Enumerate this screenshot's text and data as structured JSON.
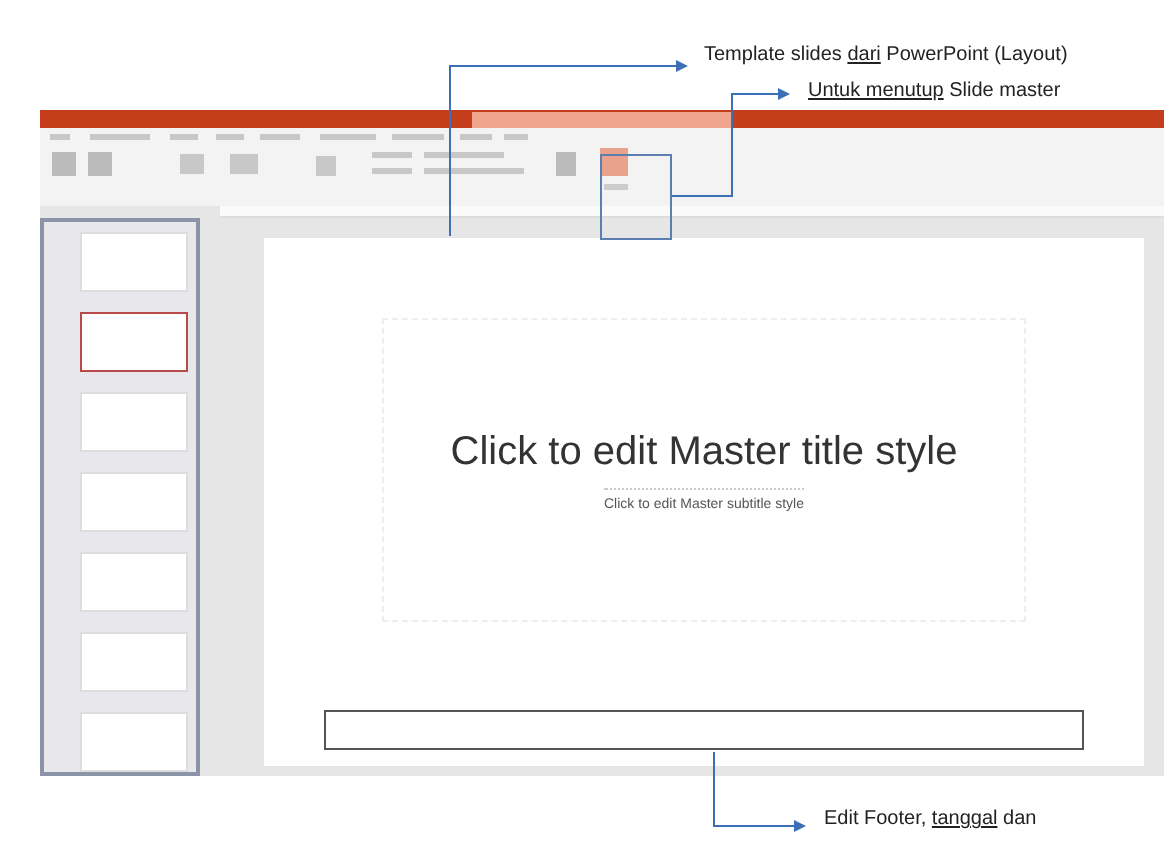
{
  "annotations": [
    {
      "kind": "layout",
      "parts": [
        {
          "text": "Template slides ",
          "underlined": false
        },
        {
          "text": "dari",
          "underlined": true
        },
        {
          "text": " PowerPoint (Layout)",
          "underlined": false
        }
      ]
    },
    {
      "kind": "close",
      "parts": [
        {
          "text": "Untuk menutup",
          "underlined": true
        },
        {
          "text": " Slide master",
          "underlined": false
        }
      ]
    },
    {
      "kind": "footer",
      "parts": [
        {
          "text": "Edit Footer, ",
          "underlined": false
        },
        {
          "text": "tanggal",
          "underlined": true
        },
        {
          "text": " dan",
          "underlined": false
        }
      ]
    }
  ],
  "thumbnails": [
    {
      "selected": false
    },
    {
      "selected": true
    },
    {
      "selected": false
    },
    {
      "selected": false
    },
    {
      "selected": false
    },
    {
      "selected": false
    },
    {
      "selected": false
    }
  ],
  "slide": {
    "title": "Click to edit Master title style",
    "subtitle": "Click to edit Master subtitle style"
  }
}
